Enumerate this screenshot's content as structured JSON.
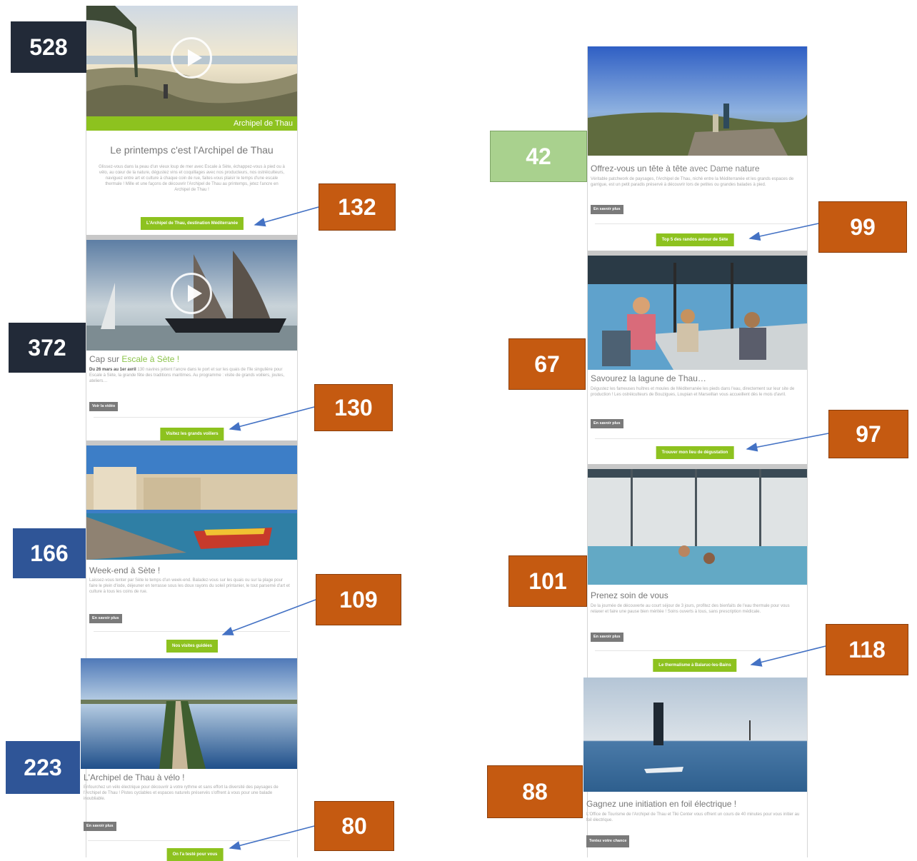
{
  "left": {
    "s1": {
      "banner": "Archipel de Thau",
      "title": "Le printemps c'est l'Archipel de Thau",
      "body": "Glissez-vous dans la peau d'un vieux loup de mer avec Escale à Sète, échappez-vous à pied ou à vélo, au cœur de la nature, dégustez vins et coquillages avec nos producteurs, nos ostréiculteurs, naviguez entre art et culture à chaque coin de rue, faites-vous plaisir le temps d'une escale thermale ! Mille et une façons de découvrir l'Archipel de Thau au printemps, jetez l'ancre en Archipel de Thau !",
      "cta": "L'Archipel de Thau, destination Méditerranée"
    },
    "s2": {
      "title_a": "Cap sur ",
      "title_b": "Escale à Sète !",
      "body_bold": "Du 26 mars au 1er avril",
      "body": " 130 navires jettent l'ancre dans le port et sur les quais de l'île singulière pour Escale à Sète, la grande fête des traditions maritimes. Au programme : visite de grands voiliers, joutes, ateliers…",
      "btn": "Voir la vidéo",
      "cta": "Visitez les grands voiliers"
    },
    "s3": {
      "title": "Week-end à Sète !",
      "body": "Laissez-vous tenter par Sète le temps d'un week-end. Baladez-vous sur les quais ou sur la plage pour faire le plein d'iode, déjeuner en terrasse sous les doux rayons du soleil printanier, le tout parsemé d'art et culture à tous les coins de rue.",
      "btn": "En savoir plus",
      "cta": "Nos visites guidées"
    },
    "s4": {
      "title": "L'Archipel de Thau à vélo !",
      "body": "Enfourchez un vélo électrique pour découvrir à votre rythme et sans effort la diversité des paysages de l'Archipel de Thau ! Pistes cyclables et espaces naturels préservés s'offrent à vous pour une balade inoubliable.",
      "btn": "En savoir plus",
      "cta": "On l'a testé pour vous"
    }
  },
  "right": {
    "s1": {
      "title_a": "Offrez-vous un tête à tête ",
      "title_b": "avec Dame nature",
      "body": "Véritable patchwork de paysages, l'Archipel de Thau, niché entre la Méditerranée et les grands espaces de garrigue, est un petit paradis préservé à découvrir lors de petites ou grandes balades à pied.",
      "btn": "En savoir plus",
      "cta": "Top 5 des randos autour de Sète"
    },
    "s2": {
      "title": "Savourez la lagune de Thau…",
      "body": "Dégustez les fameuses huîtres et moules de Méditerranée les pieds dans l'eau, directement sur leur site de production ! Les ostréiculteurs de Bouzigues, Loupian et Marseillan vous accueillent dès le mois d'avril.",
      "btn": "En savoir plus",
      "cta": "Trouver mon lieu de dégustation"
    },
    "s3": {
      "title": "Prenez soin de vous",
      "body": "De la journée de découverte au court séjour de 3 jours, profitez des bienfaits de l'eau thermale pour vous relaxer et faire une pause bien méritée ! Soins ouverts à tous, sans prescription médicale.",
      "btn": "En savoir plus",
      "cta": "Le thermalisme à Balaruc-les-Bains"
    },
    "s4": {
      "title": "Gagnez une initiation en foil électrique !",
      "body": "L'Office de Tourisme de l'Archipel de Thau et Tiki Center vous offrent un cours de 40 minutes pour vous initier au foil électrique.",
      "btn": "Tentez votre chance"
    }
  },
  "badges": {
    "b528": "528",
    "b132": "132",
    "b372": "372",
    "b130": "130",
    "b166": "166",
    "b109": "109",
    "b223": "223",
    "b80": "80",
    "b42": "42",
    "b99": "99",
    "b67": "67",
    "b97": "97",
    "b101": "101",
    "b118": "118",
    "b88": "88"
  },
  "colors": {
    "accent_green": "#8dc21f",
    "badge_navy": "#222a38",
    "badge_blue": "#2f5597",
    "badge_orange": "#c55a11",
    "badge_light_green": "#a9d18e",
    "arrow_blue": "#4472c4"
  }
}
